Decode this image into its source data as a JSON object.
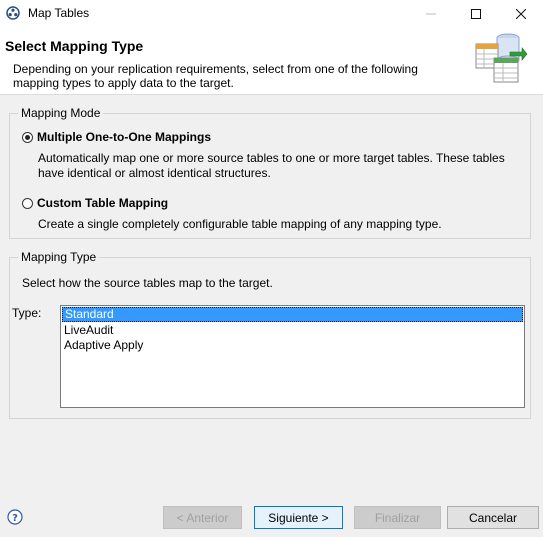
{
  "window": {
    "title": "Map Tables"
  },
  "header": {
    "title": "Select Mapping Type",
    "description": "Depending on your replication requirements, select from one of the following mapping types to apply data to the target."
  },
  "mapping_mode": {
    "label": "Mapping Mode",
    "options": [
      {
        "label": "Multiple One-to-One Mappings",
        "description": "Automatically map one or more source tables to one or more target tables. These tables have identical or almost identical structures.",
        "selected": true
      },
      {
        "label": "Custom Table Mapping",
        "description": "Create a single completely configurable table mapping of any mapping type.",
        "selected": false
      }
    ]
  },
  "mapping_type": {
    "label": "Mapping Type",
    "instruction": "Select how the source tables map to the target.",
    "type_label": "Type:",
    "items": [
      "Standard",
      "LiveAudit",
      "Adaptive Apply"
    ],
    "selected_item": "Standard"
  },
  "buttons": {
    "back": "< Anterior",
    "next": "Siguiente >",
    "finish": "Finalizar",
    "cancel": "Cancelar"
  }
}
